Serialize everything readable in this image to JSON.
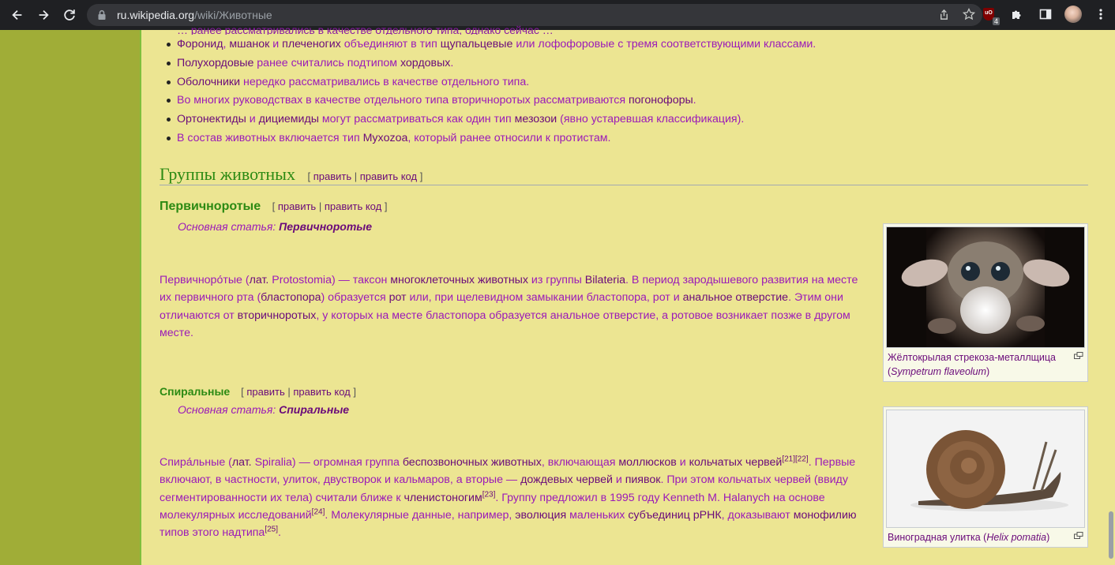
{
  "browser": {
    "url_host": "ru.wikipedia.org",
    "url_path": "/wiki/Животные",
    "ublock_count": "4",
    "ublock_label": "uO"
  },
  "cut_line": "… ранее рассматривались в качестве отдельного типа, однако сейчас …",
  "list_items": [
    [
      {
        "t": "Форонид",
        "l": true
      },
      {
        "t": ", ",
        "l": false
      },
      {
        "t": "мшанок",
        "l": true
      },
      {
        "t": " и ",
        "l": false
      },
      {
        "t": "плеченогих",
        "l": true
      },
      {
        "t": " объединяют в тип ",
        "l": false
      },
      {
        "t": "щупальцевые",
        "l": true
      },
      {
        "t": " или лофофоровые с тремя соответствующими классами.",
        "l": false
      }
    ],
    [
      {
        "t": "Полухордовые",
        "l": true
      },
      {
        "t": " ранее считались подтипом ",
        "l": false
      },
      {
        "t": "хордовых",
        "l": true
      },
      {
        "t": ".",
        "l": false
      }
    ],
    [
      {
        "t": "Оболочники",
        "l": true
      },
      {
        "t": " нередко рассматривались в качестве отдельного типа.",
        "l": false
      }
    ],
    [
      {
        "t": "Во многих руководствах в качестве отдельного типа вторичноротых рассматриваются ",
        "l": false
      },
      {
        "t": "погонофоры",
        "l": true
      },
      {
        "t": ".",
        "l": false
      }
    ],
    [
      {
        "t": "Ортонектиды",
        "l": true
      },
      {
        "t": " и ",
        "l": false
      },
      {
        "t": "дициемиды",
        "l": true
      },
      {
        "t": " могут рассматриваться как один тип ",
        "l": false
      },
      {
        "t": "мезозои",
        "l": true
      },
      {
        "t": " (явно устаревшая классификация).",
        "l": false
      }
    ],
    [
      {
        "t": "В состав животных включается тип ",
        "l": false
      },
      {
        "t": "Myxozoa",
        "l": true
      },
      {
        "t": ", который ранее относили к протистам.",
        "l": false
      }
    ]
  ],
  "section": {
    "title": "Группы животных",
    "edit": "править",
    "edit_code": "править код"
  },
  "sub1": {
    "title": "Первичноротые",
    "hatnote_prefix": "Основная статья: ",
    "hatnote_link": "Первичноротые"
  },
  "para1": [
    {
      "t": "Первичноро́тые (",
      "l": false
    },
    {
      "t": "лат.",
      "l": true
    },
    {
      "t": " Protostomia) — таксон ",
      "l": false
    },
    {
      "t": "многоклеточных животных",
      "l": true
    },
    {
      "t": " из группы ",
      "l": false
    },
    {
      "t": "Bilateria",
      "l": true
    },
    {
      "t": ". В период зародышевого развития на месте их первичного рта (",
      "l": false
    },
    {
      "t": "бластопора",
      "l": true
    },
    {
      "t": ") образуется ",
      "l": false
    },
    {
      "t": "рот",
      "l": true
    },
    {
      "t": " или, при щелевидном замыкании бластопора, рот и ",
      "l": false
    },
    {
      "t": "анальное отверстие",
      "l": true
    },
    {
      "t": ". Этим они отличаются от ",
      "l": false
    },
    {
      "t": "вторичноротых",
      "l": true
    },
    {
      "t": ", у которых на месте бластопора образуется анальное отверстие, а ротовое возникает позже в другом месте.",
      "l": false
    }
  ],
  "sub2": {
    "title": "Спиральные",
    "hatnote_prefix": "Основная статья: ",
    "hatnote_link": "Спиральные"
  },
  "para2": [
    {
      "t": "Спира́льные (",
      "l": false
    },
    {
      "t": "лат.",
      "l": true
    },
    {
      "t": " Spiralia) — огромная группа ",
      "l": false
    },
    {
      "t": "беспозвоночных животных",
      "l": true
    },
    {
      "t": ", включающая ",
      "l": false
    },
    {
      "t": "моллюсков",
      "l": true
    },
    {
      "t": " и ",
      "l": false
    },
    {
      "t": "кольчатых червей",
      "l": true
    },
    {
      "t": "[21][22]",
      "l": false,
      "sup": true
    },
    {
      "t": ". Первые включают, в частности, улиток, двустворок и кальмаров, а вторые — ",
      "l": false
    },
    {
      "t": "дождевых червей",
      "l": true
    },
    {
      "t": " и ",
      "l": false
    },
    {
      "t": "пиявок",
      "l": true
    },
    {
      "t": ". При этом кольчатых червей (ввиду сегментированности их тела) считали ближе к ",
      "l": false
    },
    {
      "t": "членистоногим",
      "l": true
    },
    {
      "t": "[23]",
      "l": false,
      "sup": true
    },
    {
      "t": ". Группу предложил в 1995 году Kenneth M. Halanych на основе молекулярных исследований",
      "l": false
    },
    {
      "t": "[24]",
      "l": false,
      "sup": true
    },
    {
      "t": ". Молекулярные данные, например, ",
      "l": false
    },
    {
      "t": "эволюция",
      "l": true
    },
    {
      "t": " маленьких ",
      "l": false
    },
    {
      "t": "субъединиц рРНК",
      "l": true
    },
    {
      "t": ", доказывают ",
      "l": false
    },
    {
      "t": "монофилию",
      "l": true
    },
    {
      "t": " типов этого надтипа",
      "l": false
    },
    {
      "t": "[25]",
      "l": false,
      "sup": true
    },
    {
      "t": ".",
      "l": false
    }
  ],
  "thumb1": {
    "caption": "Жёлтокрылая стрекоза-металлщица",
    "caption_latin": "Sympetrum flaveolum"
  },
  "thumb2": {
    "caption": "Виноградная улитка",
    "caption_latin": "Helix pomatia"
  },
  "colors": {
    "page_bg": "#ece592",
    "sidebar": "#a0ad37",
    "text": "#9b1ab8",
    "link": "#6a0a7a",
    "heading": "#2c8a13"
  }
}
